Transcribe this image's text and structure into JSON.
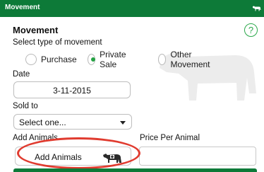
{
  "header": {
    "title": "Movement",
    "icon": "cow-icon",
    "color": "#0d7a38"
  },
  "form": {
    "heading": "Movement",
    "help_label": "?",
    "movement_type_label": "Select type of movement",
    "movement_options": [
      {
        "label": "Purchase",
        "selected": false
      },
      {
        "label": "Private Sale",
        "selected": true
      },
      {
        "label": "Other Movement",
        "selected": false
      }
    ],
    "date_label": "Date",
    "date_value": "3-11-2015",
    "sold_to_label": "Sold to",
    "sold_to_value": "Select one...",
    "add_animals_label": "Add Animals",
    "price_label": "Price Per Animal",
    "add_animals_button": "Add Animals",
    "price_value": ""
  },
  "colors": {
    "accent": "#25a244",
    "highlight": "#e03b2f"
  }
}
